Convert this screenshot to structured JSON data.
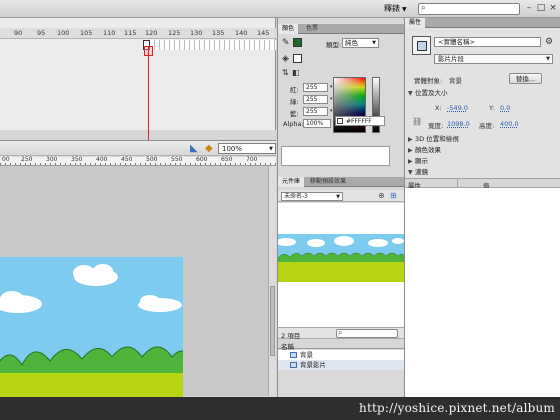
{
  "topbar": {
    "workspace_label": "釋錶",
    "window_buttons": [
      "–",
      "□",
      "×"
    ]
  },
  "timeline": {
    "ruler_numbers": [
      "90",
      "95",
      "100",
      "105",
      "110",
      "115",
      "120",
      "125",
      "130",
      "135",
      "140",
      "145"
    ],
    "current_frame": 120
  },
  "stage": {
    "zoom_value": "100%",
    "ruler_numbers": [
      "00",
      "250",
      "300",
      "350",
      "400",
      "450",
      "500",
      "550",
      "600",
      "650",
      "700"
    ]
  },
  "color_panel": {
    "tabs": [
      "顏色",
      "色票"
    ],
    "type_label": "類型:",
    "type_value": "純色",
    "red_label": "紅:",
    "red_value": "255",
    "green_label": "綠:",
    "green_value": "255",
    "blue_label": "藍:",
    "blue_value": "255",
    "alpha_label": "Alpha:",
    "alpha_value": "100%",
    "hex_value": "#FFFFFF"
  },
  "library_panel": {
    "tabs": [
      "元件庫",
      "移動預設效果"
    ],
    "document_name": "未命名-3",
    "item_count": "2 項目",
    "column_name": "名稱",
    "items": [
      {
        "name": "背景"
      },
      {
        "name": "背景影片"
      }
    ]
  },
  "properties_panel": {
    "tab": "屬性",
    "instance_name_placeholder": "<實體名稱>",
    "instance_type": "影片片段",
    "instance_of_label": "實體對象:",
    "instance_of_value": "背景",
    "swap_button": "替換...",
    "section_position": "位置及大小",
    "x_label": "X:",
    "x_value": "-549.0",
    "y_label": "Y:",
    "y_value": "0.0",
    "width_label": "寬度:",
    "width_value": "1098.0",
    "height_label": "高度:",
    "height_value": "400.0",
    "sections_collapsed": [
      "3D 位置和檢視",
      "顏色效果",
      "顯示"
    ],
    "section_filters": "濾鏡",
    "filter_columns": [
      "屬性",
      "值"
    ]
  },
  "watermark": {
    "text": "http://yoshice.pixnet.net/album"
  }
}
